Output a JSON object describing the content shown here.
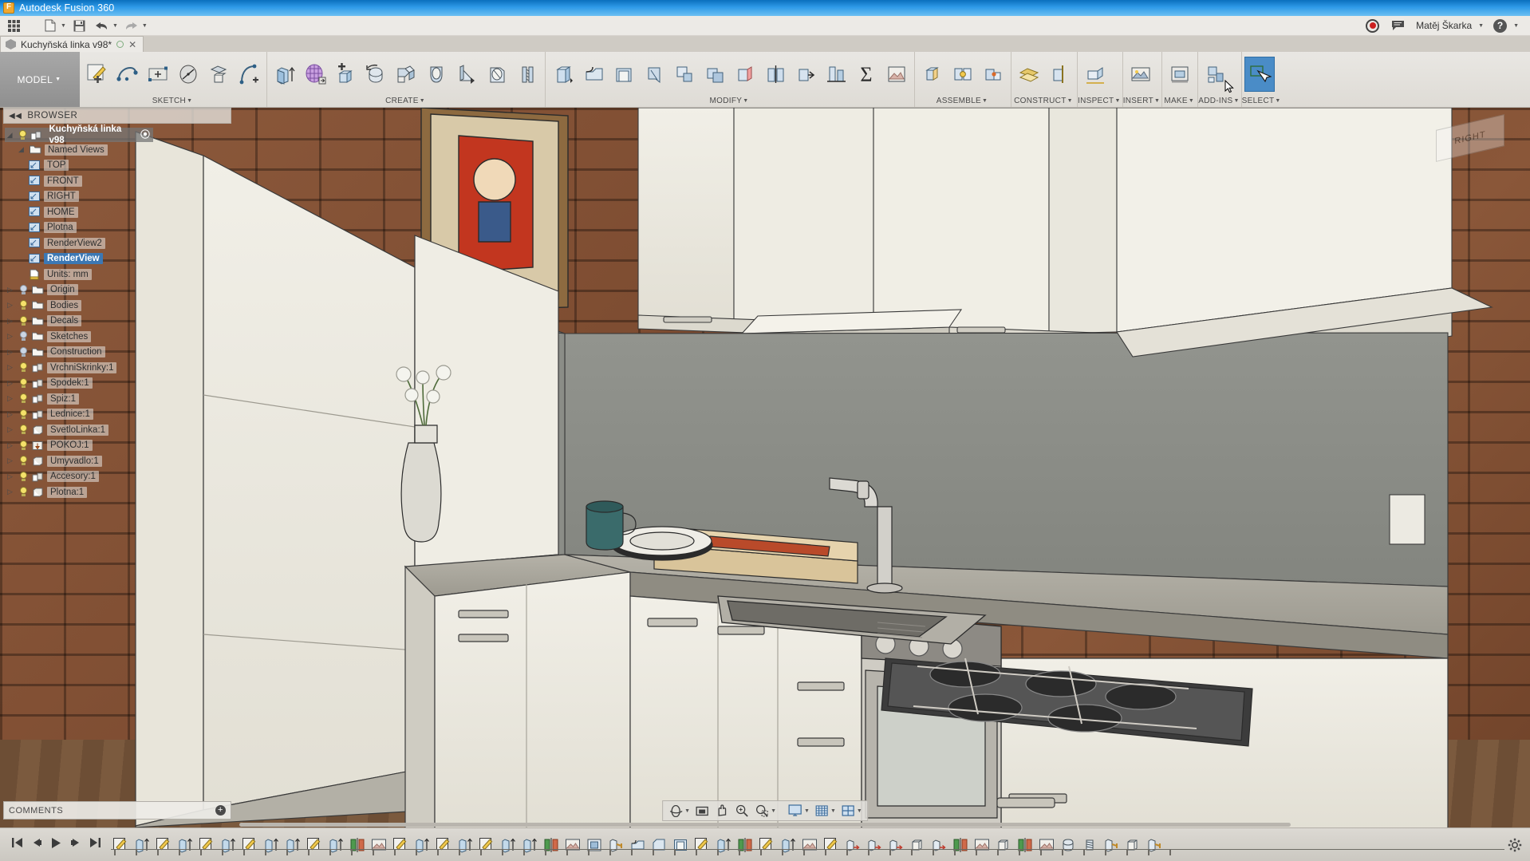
{
  "window": {
    "title": "Autodesk Fusion 360",
    "app_icon": "fusion-logo-icon"
  },
  "quick_access": {
    "left_buttons": [
      {
        "name": "app-grid-icon",
        "label": "☰"
      },
      {
        "name": "new-file-icon",
        "label": "὜B"
      },
      {
        "name": "save-icon",
        "label": "save"
      },
      {
        "name": "undo-icon",
        "label": "undo"
      },
      {
        "name": "redo-icon",
        "label": "redo"
      }
    ],
    "record_label": "record-icon",
    "comment_label": "comment-icon",
    "user_name": "Matěj Škarka",
    "help_label": "?"
  },
  "document_tab": {
    "title": "Kuchyňská linka v98*",
    "close_label": "✕"
  },
  "ribbon": {
    "workspace_label": "MODEL",
    "panels": [
      {
        "label": "SKETCH",
        "tools": [
          {
            "name": "create-sketch-tool",
            "icon": "sketch-pencil"
          },
          {
            "name": "sketch-line-tool",
            "icon": "spline"
          },
          {
            "name": "sketch-rectangle-tool",
            "icon": "rect-plus"
          },
          {
            "name": "sketch-circle-tool",
            "icon": "circle-diameter"
          },
          {
            "name": "sketch-offset-plane-tool",
            "icon": "plane-box"
          },
          {
            "name": "sketch-arc-tool",
            "icon": "arc-plus"
          }
        ]
      },
      {
        "label": "CREATE",
        "tools": [
          {
            "name": "extrude-tool",
            "icon": "extrude"
          },
          {
            "name": "mesh-tool",
            "icon": "mesh-grid"
          },
          {
            "name": "box-tool",
            "icon": "box-build"
          },
          {
            "name": "revolve-tool",
            "icon": "revolve"
          },
          {
            "name": "sweep-tool",
            "icon": "sweep"
          },
          {
            "name": "loft-tool",
            "icon": "loft"
          },
          {
            "name": "rib-tool",
            "icon": "rib"
          },
          {
            "name": "hole-tool",
            "icon": "hole"
          },
          {
            "name": "thread-tool",
            "icon": "thread"
          }
        ]
      },
      {
        "label": "MODIFY",
        "tools": [
          {
            "name": "press-pull-tool",
            "icon": "press-pull"
          },
          {
            "name": "fillet-tool",
            "icon": "fillet"
          },
          {
            "name": "shell-tool",
            "icon": "shell"
          },
          {
            "name": "draft-tool",
            "icon": "draft"
          },
          {
            "name": "scale-tool",
            "icon": "scale"
          },
          {
            "name": "combine-tool",
            "icon": "combine"
          },
          {
            "name": "replace-face-tool",
            "icon": "replace-face"
          },
          {
            "name": "split-body-tool",
            "icon": "split-body"
          },
          {
            "name": "move-copy-tool",
            "icon": "move-copy"
          },
          {
            "name": "align-tool",
            "icon": "align"
          },
          {
            "name": "parameters-tool",
            "icon": "sigma"
          },
          {
            "name": "appearance-tool",
            "icon": "appearance"
          }
        ]
      },
      {
        "label": "ASSEMBLE",
        "tools": [
          {
            "name": "new-component-tool",
            "icon": "new-component"
          },
          {
            "name": "joint-tool",
            "icon": "joint"
          },
          {
            "name": "as-built-joint-tool",
            "icon": "as-built-joint"
          }
        ]
      },
      {
        "label": "CONSTRUCT",
        "tools": [
          {
            "name": "offset-plane-tool",
            "icon": "offset-plane"
          },
          {
            "name": "construction-axis-tool",
            "icon": "construction-axis"
          }
        ]
      },
      {
        "label": "INSPECT",
        "tools": [
          {
            "name": "measure-tool",
            "icon": "measure"
          }
        ]
      },
      {
        "label": "INSERT",
        "tools": [
          {
            "name": "insert-decal-tool",
            "icon": "decal"
          }
        ]
      },
      {
        "label": "MAKE",
        "tools": [
          {
            "name": "3d-print-tool",
            "icon": "3d-print"
          }
        ]
      },
      {
        "label": "ADD-INS",
        "tools": [
          {
            "name": "scripts-addins-tool",
            "icon": "addin"
          }
        ]
      },
      {
        "label": "SELECT",
        "selected": true,
        "tools": [
          {
            "name": "select-tool",
            "icon": "select-arrow"
          }
        ]
      }
    ]
  },
  "browser": {
    "header": "BROWSER",
    "collapse_icon": "collapse-left-icon",
    "root": {
      "label": "Kuchyňská linka v98",
      "type": "document-root"
    },
    "nodes": [
      {
        "label": "Named Views",
        "level": 1,
        "icon": "folder-icon",
        "expanded": true,
        "bulb": false
      },
      {
        "label": "TOP",
        "level": 2,
        "icon": "named-view-icon"
      },
      {
        "label": "FRONT",
        "level": 2,
        "icon": "named-view-icon"
      },
      {
        "label": "RIGHT",
        "level": 2,
        "icon": "named-view-icon"
      },
      {
        "label": "HOME",
        "level": 2,
        "icon": "named-view-icon"
      },
      {
        "label": "Plotna",
        "level": 2,
        "icon": "named-view-icon"
      },
      {
        "label": "RenderView2",
        "level": 2,
        "icon": "named-view-icon"
      },
      {
        "label": "RenderView",
        "level": 2,
        "icon": "named-view-icon",
        "selected": true
      },
      {
        "label": "Units: mm",
        "level": 1,
        "icon": "units-icon"
      },
      {
        "label": "Origin",
        "level": 1,
        "icon": "folder-icon",
        "arrow": true,
        "bulb_off": true
      },
      {
        "label": "Bodies",
        "level": 1,
        "icon": "folder-icon",
        "arrow": true
      },
      {
        "label": "Decals",
        "level": 1,
        "icon": "folder-icon",
        "arrow": true
      },
      {
        "label": "Sketches",
        "level": 1,
        "icon": "folder-icon",
        "arrow": true,
        "bulb_off": true
      },
      {
        "label": "Construction",
        "level": 1,
        "icon": "folder-icon",
        "arrow": true,
        "bulb_off": true
      },
      {
        "label": "VrchniSkrinky:1",
        "level": 1,
        "icon": "component-icon",
        "arrow": true
      },
      {
        "label": "Spodek:1",
        "level": 1,
        "icon": "component-icon",
        "arrow": true
      },
      {
        "label": "Spiz:1",
        "level": 1,
        "icon": "component-icon",
        "arrow": true
      },
      {
        "label": "Lednice:1",
        "level": 1,
        "icon": "component-icon",
        "arrow": true
      },
      {
        "label": "SvetloLinka:1",
        "level": 1,
        "icon": "body-icon",
        "arrow": true
      },
      {
        "label": "POKOJ:1",
        "level": 1,
        "icon": "grounded-component-icon",
        "arrow": true
      },
      {
        "label": "Umyvadlo:1",
        "level": 1,
        "icon": "body-icon",
        "arrow": true
      },
      {
        "label": "Accesory:1",
        "level": 1,
        "icon": "component-icon",
        "arrow": true
      },
      {
        "label": "Plotna:1",
        "level": 1,
        "icon": "body-icon",
        "arrow": true
      }
    ]
  },
  "comments": {
    "label": "COMMENTS",
    "add_label": "+"
  },
  "viewcube": {
    "face_label": "RIGHT"
  },
  "navbar": {
    "buttons": [
      {
        "name": "orbit-icon",
        "label": "orbit",
        "caret": true
      },
      {
        "name": "fit-icon",
        "label": "fit"
      },
      {
        "name": "pan-icon",
        "label": "pan"
      },
      {
        "name": "zoom-icon",
        "label": "zoom"
      },
      {
        "name": "zoom-window-icon",
        "label": "zoom-window",
        "caret": true
      },
      {
        "name": "display-settings-icon",
        "label": "display",
        "caret": true
      },
      {
        "name": "grid-snap-icon",
        "label": "grid",
        "caret": true
      },
      {
        "name": "viewports-icon",
        "label": "viewports",
        "caret": true
      }
    ]
  },
  "timeline": {
    "playback": [
      {
        "name": "timeline-go-start-button",
        "glyph": "◀❙"
      },
      {
        "name": "timeline-step-back-button",
        "glyph": "◀"
      },
      {
        "name": "timeline-play-button",
        "glyph": "▶"
      },
      {
        "name": "timeline-step-forward-button",
        "glyph": "▶"
      },
      {
        "name": "timeline-go-end-button",
        "glyph": "❙▶"
      }
    ],
    "features": [
      "sketch",
      "extrude",
      "sketch",
      "extrude",
      "sketch",
      "extrude",
      "sketch",
      "extrude",
      "extrude",
      "sketch",
      "extrude",
      "mirror",
      "appearance",
      "sketch",
      "extrude",
      "sketch",
      "extrude",
      "sketch",
      "extrude",
      "extrude",
      "mirror",
      "appearance",
      "component",
      "joint",
      "fillet",
      "chamfer",
      "shell",
      "sketch",
      "extrude",
      "mirror",
      "sketch",
      "extrude",
      "appearance",
      "sketch",
      "move-copy",
      "move-copy",
      "move-copy",
      "body",
      "move-copy",
      "mirror",
      "appearance",
      "box",
      "mirror",
      "appearance",
      "revolve",
      "thread",
      "joint",
      "body",
      "joint"
    ],
    "settings_label": "timeline-settings-icon"
  },
  "scene": {
    "description": "3D rendered kitchen interior with brick walls, wooden floor, white cabinets, sink, gas hob, oven, refrigerator and decorative poster",
    "colors": {
      "brick": "#7d4c31",
      "cabinet": "#e8e6dd",
      "countertop": "#a8a49b",
      "backsplash": "#8d8f8a",
      "floor": "#6d4e35",
      "accent_blue": "#4a8cc7",
      "selection_blue": "#3c78b4",
      "titlebar_blue": "#2e9ae8"
    }
  }
}
